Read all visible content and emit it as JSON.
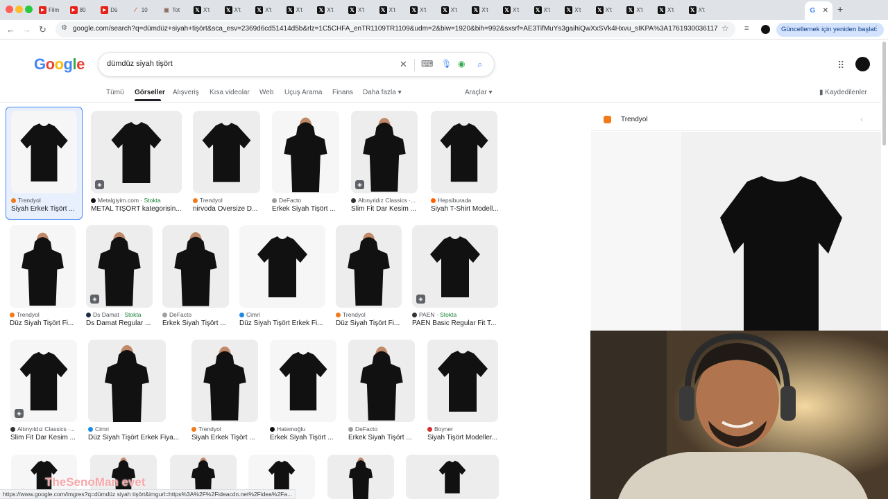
{
  "browser": {
    "tabs": [
      {
        "label": "Film",
        "icon": "youtube-icon"
      },
      {
        "label": "80",
        "icon": "youtube-icon"
      },
      {
        "label": "Dü",
        "icon": "youtube-icon"
      },
      {
        "label": "10",
        "icon": "dash-icon"
      },
      {
        "label": "Tot",
        "icon": "image-icon"
      },
      {
        "label": "X't",
        "icon": "x-icon"
      },
      {
        "label": "X't",
        "icon": "x-icon"
      },
      {
        "label": "X't",
        "icon": "x-icon"
      },
      {
        "label": "X't",
        "icon": "x-icon"
      },
      {
        "label": "X't",
        "icon": "x-icon"
      },
      {
        "label": "X't",
        "icon": "x-icon"
      },
      {
        "label": "X't",
        "icon": "x-icon"
      },
      {
        "label": "X't",
        "icon": "x-icon"
      },
      {
        "label": "X't",
        "icon": "x-icon"
      },
      {
        "label": "X't",
        "icon": "x-icon"
      },
      {
        "label": "X't",
        "icon": "x-icon"
      },
      {
        "label": "X't",
        "icon": "x-icon"
      },
      {
        "label": "X't",
        "icon": "x-icon"
      },
      {
        "label": "X't",
        "icon": "x-icon"
      },
      {
        "label": "X't",
        "icon": "x-icon"
      },
      {
        "label": "X't",
        "icon": "x-icon"
      },
      {
        "label": "X't",
        "icon": "x-icon"
      }
    ],
    "active_tab_glyph": "G",
    "new_tab": "+",
    "url": "google.com/search?q=dümdüz+siyah+tişört&sca_esv=2369d6cd51414d5b&rlz=1C5CHFA_enTR1109TR1109&udm=2&biw=1920&bih=992&sxsrf=AE3TifMuYs3gaihiQwXxSVk4Hxvu_sIKPA%3A1761930036117&...",
    "update_button": "Güncellemek için yeniden başlat",
    "status_url": "https://www.google.com/imgres?q=dümdüz siyah tişört&imgurl=https%3A%2F%2Fideacdn.net%2Fidea%2Fa..."
  },
  "google": {
    "logo_letters": [
      {
        "ch": "G",
        "color": "#4285f4"
      },
      {
        "ch": "o",
        "color": "#ea4335"
      },
      {
        "ch": "o",
        "color": "#fbbc05"
      },
      {
        "ch": "g",
        "color": "#4285f4"
      },
      {
        "ch": "l",
        "color": "#34a853"
      },
      {
        "ch": "e",
        "color": "#ea4335"
      }
    ],
    "query": "dümdüz siyah tişört",
    "filters": [
      "Tümü",
      "Görseller",
      "Alışveriş",
      "Kısa videolar",
      "Web",
      "Uçuş Arama",
      "Finans",
      "Daha fazla ▾"
    ],
    "active_filter": "Görseller",
    "tools": "Araçlar ▾",
    "saved": "Kaydedilenler"
  },
  "results": [
    {
      "source": "Trendyol",
      "title": "Siyah Erkek Tişört ...",
      "src_color": "#f27a1a",
      "stock": ""
    },
    {
      "source": "Metalgiyim.com",
      "title": "METAL TİŞÖRT kategorisin...",
      "src_color": "#111111",
      "stock": "Stokta"
    },
    {
      "source": "Trendyol",
      "title": "nirvoda Oversize D...",
      "src_color": "#f27a1a",
      "stock": ""
    },
    {
      "source": "DeFacto",
      "title": "Erkek Siyah Tişört ...",
      "src_color": "#9e9e9e",
      "stock": ""
    },
    {
      "source": "Altınyıldız Classics ·...",
      "title": "Slim Fit Dar Kesim ...",
      "src_color": "#333333",
      "stock": ""
    },
    {
      "source": "Hepsiburada",
      "title": "Siyah T-Shirt Modell...",
      "src_color": "#ff6000",
      "stock": ""
    },
    {
      "source": "Trendyol",
      "title": "Düz Siyah Tişört Fi...",
      "src_color": "#f27a1a",
      "stock": ""
    },
    {
      "source": "Ds Damat",
      "title": "Ds Damat Regular ...",
      "src_color": "#1c2a48",
      "stock": "Stokta"
    },
    {
      "source": "DeFacto",
      "title": "Erkek Siyah Tişört ...",
      "src_color": "#9e9e9e",
      "stock": ""
    },
    {
      "source": "Cimri",
      "title": "Düz Siyah Tişört Erkek Fi...",
      "src_color": "#1e88e5",
      "stock": ""
    },
    {
      "source": "Trendyol",
      "title": "Düz Siyah Tişört Fi...",
      "src_color": "#f27a1a",
      "stock": ""
    },
    {
      "source": "PAEN",
      "title": "PAEN Basic Regular Fit T...",
      "src_color": "#333333",
      "stock": "Stokta"
    },
    {
      "source": "Altınyıldız Classics ·...",
      "title": "Slim Fit Dar Kesim ...",
      "src_color": "#333333",
      "stock": ""
    },
    {
      "source": "Cimri",
      "title": "Düz Siyah Tişört Erkek Fiya...",
      "src_color": "#1e88e5",
      "stock": ""
    },
    {
      "source": "Trendyol",
      "title": "Siyah Erkek Tişört ...",
      "src_color": "#f27a1a",
      "stock": ""
    },
    {
      "source": "Hatemoğlu",
      "title": "Erkek Siyah Tişört ...",
      "src_color": "#111111",
      "stock": ""
    },
    {
      "source": "DeFacto",
      "title": "Erkek Siyah Tişört ...",
      "src_color": "#9e9e9e",
      "stock": ""
    },
    {
      "source": "Boyner",
      "title": "Siyah Tişört Modeller...",
      "src_color": "#d32f2f",
      "stock": ""
    },
    {
      "source": "",
      "title": "",
      "src_color": "#9e9e9e",
      "stock": ""
    },
    {
      "source": "",
      "title": "",
      "src_color": "#9e9e9e",
      "stock": ""
    },
    {
      "source": "",
      "title": "",
      "src_color": "#9e9e9e",
      "stock": ""
    },
    {
      "source": "",
      "title": "",
      "src_color": "#9e9e9e",
      "stock": ""
    },
    {
      "source": "",
      "title": "",
      "src_color": "#9e9e9e",
      "stock": ""
    },
    {
      "source": "",
      "title": "",
      "src_color": "#9e9e9e",
      "stock": ""
    }
  ],
  "panel": {
    "source": "Trendyol"
  },
  "watermark": "TheSenoMan  evet"
}
